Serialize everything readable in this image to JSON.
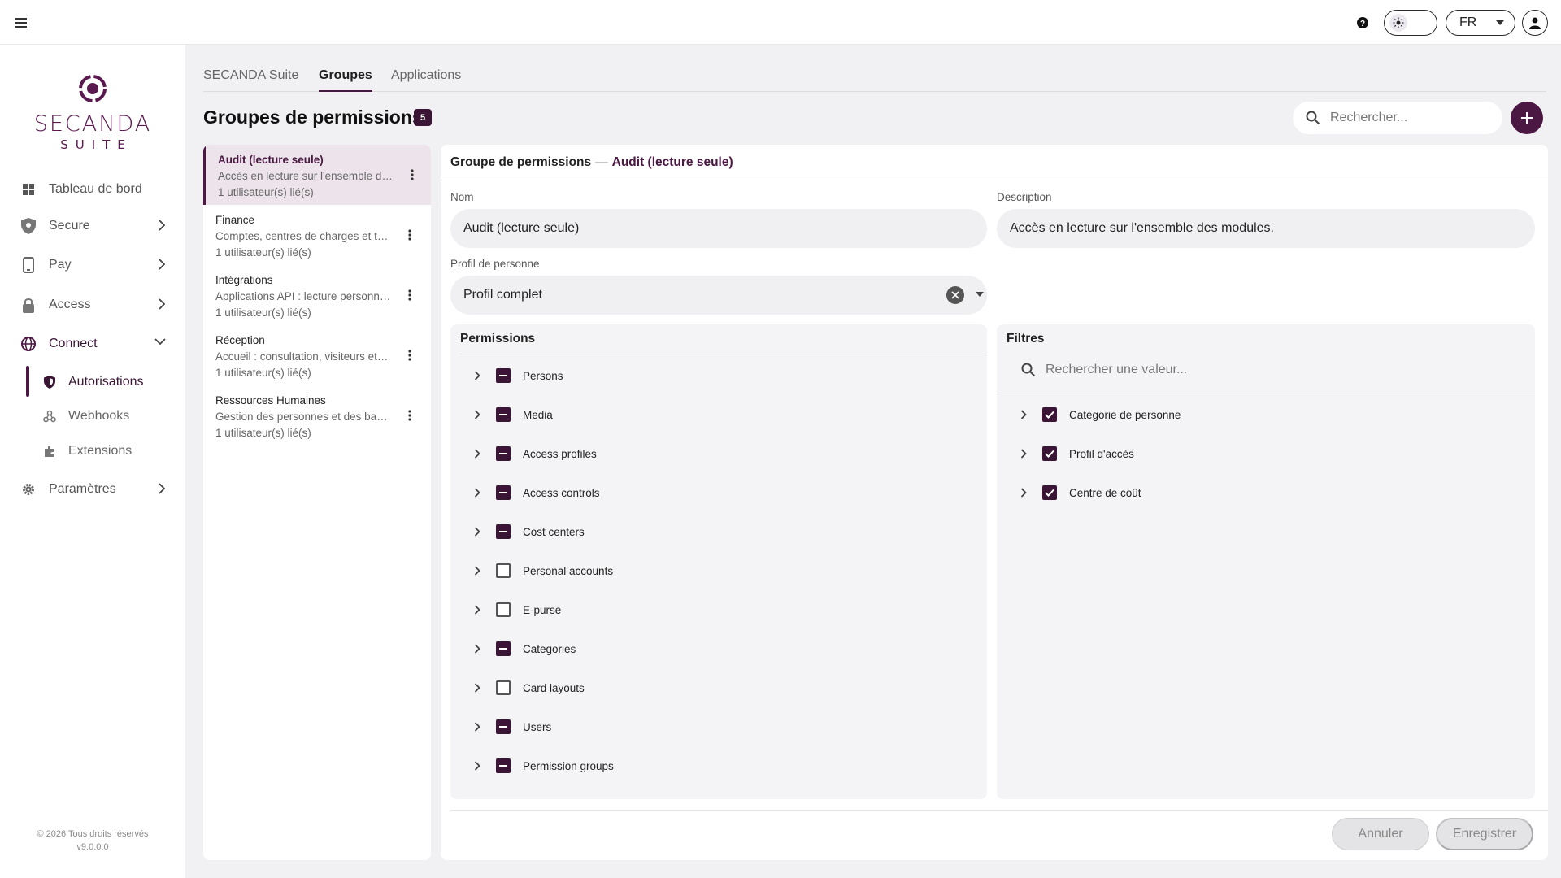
{
  "topbar": {
    "language": "FR",
    "icons": {
      "menu": "hamburger-icon",
      "help": "help-icon",
      "theme": "sun-icon",
      "user": "user-icon"
    }
  },
  "brand": {
    "name": "SECANDA",
    "sub": "SUITE",
    "color": "#5a1a4f"
  },
  "sidebar": {
    "items": [
      {
        "label": "Tableau de bord",
        "icon": "dashboard-icon"
      },
      {
        "label": "Secure",
        "icon": "shield-icon"
      },
      {
        "label": "Pay",
        "icon": "phone-icon"
      },
      {
        "label": "Access",
        "icon": "lock-icon"
      },
      {
        "label": "Connect",
        "icon": "globe-icon"
      }
    ],
    "subitems": [
      {
        "label": "Autorisations",
        "icon": "shield-icon"
      },
      {
        "label": "Webhooks",
        "icon": "webhook-icon"
      },
      {
        "label": "Extensions",
        "icon": "puzzle-icon"
      }
    ],
    "settings": {
      "label": "Paramètres",
      "icon": "gear-icon"
    },
    "footer": {
      "copyright": "© 2026 Tous droits réservés",
      "version": "v9.0.0.0"
    }
  },
  "tabs": [
    "SECANDA Suite",
    "Groupes",
    "Applications"
  ],
  "active_tab": "Groupes",
  "page": {
    "title": "Groupes de permissions",
    "count": "5"
  },
  "search": {
    "placeholder": "Rechercher..."
  },
  "groups": [
    {
      "name": "Audit (lecture seule)",
      "description": "Accès en lecture sur l'ensemble des modules.",
      "users": "1 utilisateur(s) lié(s)"
    },
    {
      "name": "Finance",
      "description": "Comptes, centres de charges et tarifs.",
      "users": "1 utilisateur(s) lié(s)"
    },
    {
      "name": "Intégrations",
      "description": "Applications API : lecture personnes et accès.",
      "users": "1 utilisateur(s) lié(s)"
    },
    {
      "name": "Réception",
      "description": "Accueil : consultation, visiteurs et badges.",
      "users": "1 utilisateur(s) lié(s)"
    },
    {
      "name": "Ressources Humaines",
      "description": "Gestion des personnes et des badges.",
      "users": "1 utilisateur(s) lié(s)"
    }
  ],
  "detail": {
    "header_prefix": "Groupe de permissions",
    "header_sep": "—",
    "header_name": "Audit (lecture seule)",
    "name_label": "Nom",
    "name_value": "Audit (lecture seule)",
    "desc_label": "Description",
    "desc_value": "Accès en lecture sur l'ensemble des modules.",
    "profile_label": "Profil de personne",
    "profile_value": "Profil complet",
    "permissions_title": "Permissions",
    "permissions": [
      {
        "label": "Persons",
        "state": "indeterminate"
      },
      {
        "label": "Media",
        "state": "indeterminate"
      },
      {
        "label": "Access profiles",
        "state": "indeterminate"
      },
      {
        "label": "Access controls",
        "state": "indeterminate"
      },
      {
        "label": "Cost centers",
        "state": "indeterminate"
      },
      {
        "label": "Personal accounts",
        "state": "unchecked"
      },
      {
        "label": "E-purse",
        "state": "unchecked"
      },
      {
        "label": "Categories",
        "state": "indeterminate"
      },
      {
        "label": "Card layouts",
        "state": "unchecked"
      },
      {
        "label": "Users",
        "state": "indeterminate"
      },
      {
        "label": "Permission groups",
        "state": "indeterminate"
      }
    ],
    "filters_title": "Filtres",
    "filters_placeholder": "Rechercher une valeur...",
    "filters": [
      {
        "label": "Catégorie de personne",
        "state": "checked"
      },
      {
        "label": "Profil d'accès",
        "state": "checked"
      },
      {
        "label": "Centre de coût",
        "state": "checked"
      }
    ],
    "cancel_label": "Annuler",
    "save_label": "Enregistrer"
  },
  "colors": {
    "accent": "#4a1842",
    "accent_dark": "#3a1535",
    "selected_bg": "#ece4ea"
  }
}
